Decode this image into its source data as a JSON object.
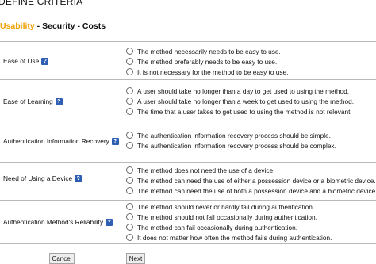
{
  "page": {
    "title": "DEFINE CRITERIA",
    "steps": [
      "Usability",
      " - Security",
      " - Costs"
    ]
  },
  "criteria": [
    {
      "label": "Ease of Use",
      "options": [
        "The method necessarily needs to be easy to use.",
        "The method preferably needs to be easy to use.",
        "It is not necessary for the method to be easy to use."
      ]
    },
    {
      "label": "Ease of Learning",
      "options": [
        "A user should take no longer than a day to get used to using the method.",
        "A user should take no longer than a week to get used to using the method.",
        "The time that a user takes to get used to using the method is not relevant."
      ]
    },
    {
      "label": "Authentication Information Recovery",
      "options": [
        "The authentication information recovery process should be simple.",
        "The authentication information recovery process should be complex."
      ]
    },
    {
      "label": "Need of Using a Device",
      "options": [
        "The method does not need the use of a device.",
        "The method can need the use of either a possession device or a biometric device.",
        "The method can need the use of both a possession device and a biometric device."
      ]
    },
    {
      "label": "Authentication Method's Reliability",
      "options": [
        "The method should never or hardly fail during authentication.",
        "The method should not fail occasionally during authentication.",
        "The method can fail occasionally during authentication.",
        "It does not matter how often the method fails during authentication."
      ]
    }
  ],
  "help_icon_text": "?",
  "buttons": {
    "cancel": "Cancel",
    "next": "Next"
  }
}
